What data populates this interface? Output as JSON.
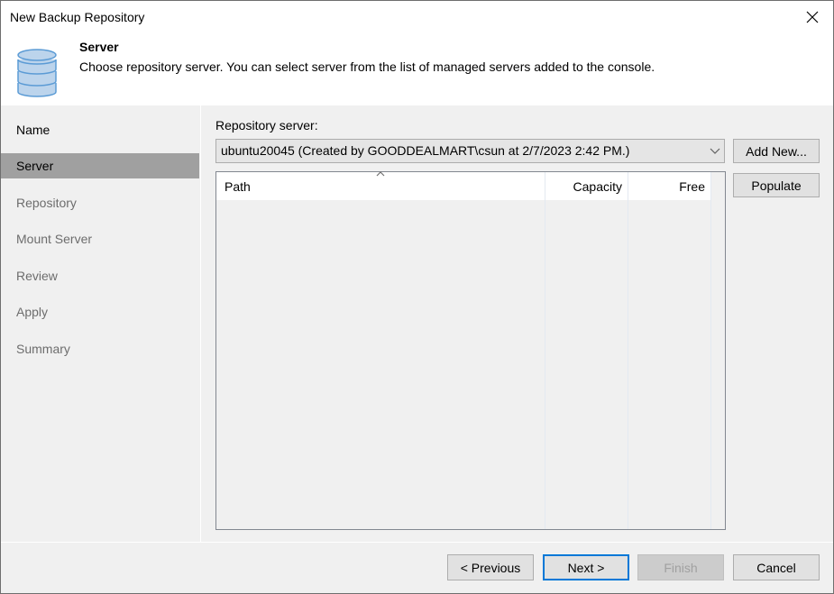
{
  "window": {
    "title": "New Backup Repository",
    "close_icon": "close-icon"
  },
  "header": {
    "icon": "database-icon",
    "title": "Server",
    "description": "Choose repository server. You can select server from the list of managed servers added to the console."
  },
  "sidebar": {
    "steps": [
      {
        "label": "Name",
        "state": "done"
      },
      {
        "label": "Server",
        "state": "active"
      },
      {
        "label": "Repository",
        "state": "pending"
      },
      {
        "label": "Mount Server",
        "state": "pending"
      },
      {
        "label": "Review",
        "state": "pending"
      },
      {
        "label": "Apply",
        "state": "pending"
      },
      {
        "label": "Summary",
        "state": "pending"
      }
    ]
  },
  "main": {
    "repository_server_label": "Repository server:",
    "repository_server_value": "ubuntu20045 (Created by GOODDEALMART\\csun at 2/7/2023 2:42 PM.)",
    "add_new_label": "Add New...",
    "populate_label": "Populate",
    "table": {
      "columns": [
        "Path",
        "Capacity",
        "Free"
      ],
      "sorted_column": "Path",
      "rows": []
    }
  },
  "footer": {
    "previous_label": "< Previous",
    "next_label": "Next >",
    "finish_label": "Finish",
    "cancel_label": "Cancel"
  },
  "colors": {
    "accent": "#0078d7",
    "active_step_bg": "#a0a0a0",
    "icon_fill": "#bcd4ec",
    "icon_stroke": "#5b9bd5"
  }
}
